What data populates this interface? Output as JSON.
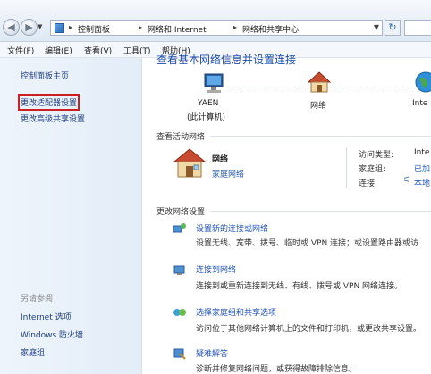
{
  "address_bar": {
    "crumbs": [
      "控制面板",
      "网络和 Internet",
      "网络和共享中心"
    ],
    "refresh_icon": "refresh-icon"
  },
  "menu": [
    "文件(F)",
    "编辑(E)",
    "查看(V)",
    "工具(T)",
    "帮助(H)"
  ],
  "sidebar": {
    "items": [
      "控制面板主页",
      "更改适配器设置",
      "更改高级共享设置"
    ],
    "see_also_title": "另请参阅",
    "see_also": [
      "Internet 选项",
      "Windows 防火墙",
      "家庭组"
    ]
  },
  "main": {
    "heading": "查看基本网络信息并设置连接",
    "map": {
      "computer_name": "YAEN",
      "computer_sub": "(此计算机)",
      "network_label": "网络",
      "internet_label": "Inte"
    },
    "active_title": "查看活动网络",
    "active_network": {
      "name": "网络",
      "type": "家庭网络",
      "access_label": "访问类型:",
      "access_value": "Inte",
      "homegroup_label": "家庭组:",
      "homegroup_value": "已加",
      "connections_label": "连接:",
      "connections_value": "本地"
    },
    "change_title": "更改网络设置",
    "tasks": [
      {
        "title": "设置新的连接或网络",
        "desc": "设置无线、宽带、拨号、临时或 VPN 连接；或设置路由器或访"
      },
      {
        "title": "连接到网络",
        "desc": "连接到或重新连接到无线、有线、拨号或 VPN 网络连接。"
      },
      {
        "title": "选择家庭组和共享选项",
        "desc": "访问位于其他网络计算机上的文件和打印机，或更改共享设置。"
      },
      {
        "title": "疑难解答",
        "desc": "诊断并修复网络问题，或获得故障排除信息。"
      }
    ]
  },
  "colors": {
    "link": "#1f52b5",
    "highlight_box": "#cc2020"
  }
}
